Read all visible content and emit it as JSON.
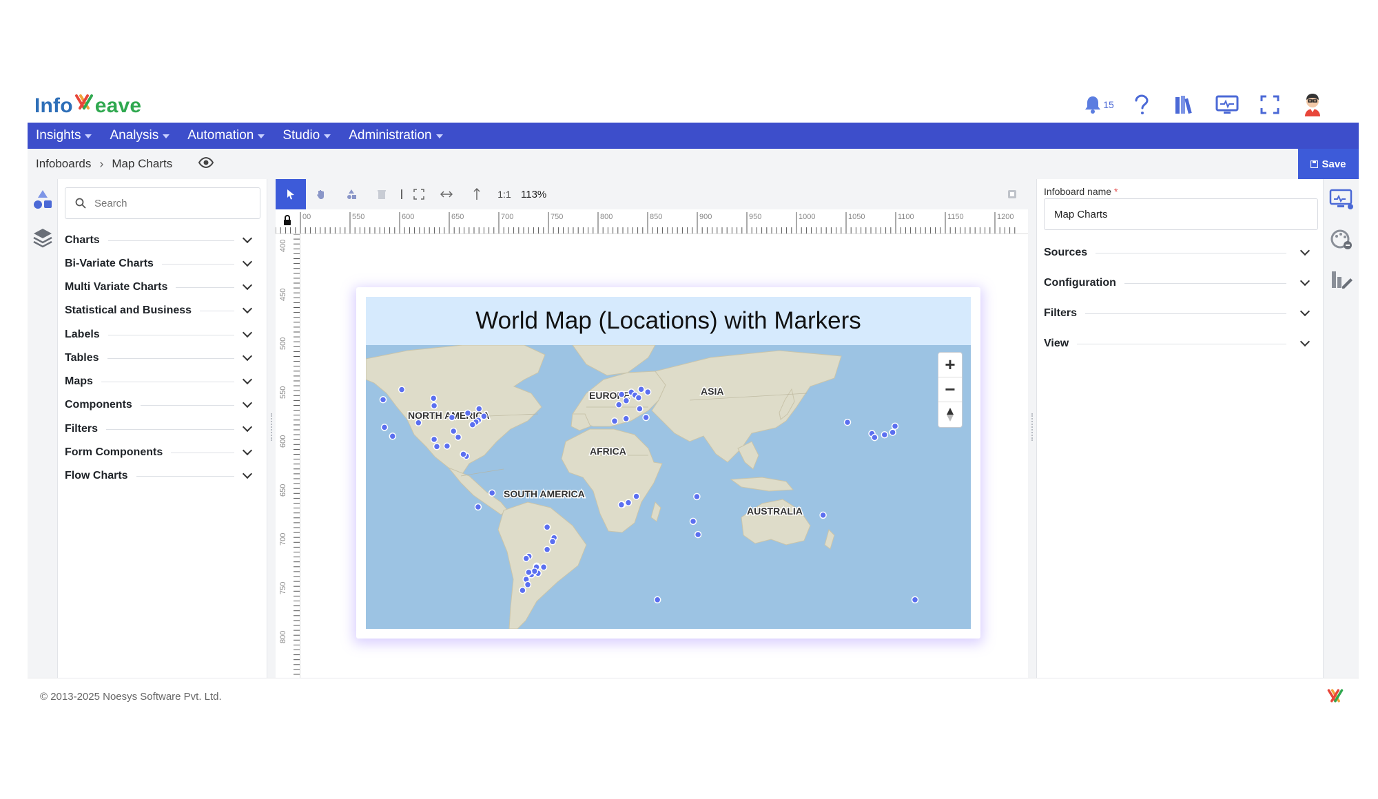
{
  "brand": {
    "name_prefix": "Info",
    "name_suffix": "eave"
  },
  "header": {
    "notification_count": "15"
  },
  "menu": [
    {
      "label": "Insights"
    },
    {
      "label": "Analysis"
    },
    {
      "label": "Automation"
    },
    {
      "label": "Studio"
    },
    {
      "label": "Administration"
    }
  ],
  "breadcrumb": {
    "root": "Infoboards",
    "current": "Map Charts"
  },
  "toolbar": {
    "save_label": "Save",
    "zoom": "113%",
    "ratio": "1:1"
  },
  "components": {
    "search_placeholder": "Search",
    "categories": [
      {
        "label": "Charts"
      },
      {
        "label": "Bi-Variate Charts"
      },
      {
        "label": "Multi Variate Charts"
      },
      {
        "label": "Statistical and Business"
      },
      {
        "label": "Labels"
      },
      {
        "label": "Tables"
      },
      {
        "label": "Maps"
      },
      {
        "label": "Components"
      },
      {
        "label": "Filters"
      },
      {
        "label": "Form Components"
      },
      {
        "label": "Flow Charts"
      }
    ]
  },
  "ruler": {
    "top_ticks": [
      "00",
      "550",
      "600",
      "650",
      "700",
      "750",
      "800",
      "850",
      "900",
      "950",
      "1000",
      "1050",
      "1100",
      "1150",
      "1200"
    ],
    "left_ticks": [
      "400",
      "450",
      "500",
      "550",
      "600",
      "650",
      "700",
      "750",
      "800"
    ]
  },
  "chart": {
    "title": "World Map (Locations) with Markers",
    "regions": [
      "NORTH AMERICA",
      "EUROPE",
      "ASIA",
      "AFRICA",
      "SOUTH AMERICA",
      "AUSTRALIA"
    ],
    "zoom_in": "+",
    "zoom_out": "−"
  },
  "chart_data": {
    "type": "scatter",
    "title": "World Map (Locations) with Markers",
    "marker_color": "#5b6ff0",
    "markers": [
      {
        "lon": -123.1,
        "lat": 49.3
      },
      {
        "lon": -113.5,
        "lat": 53.5
      },
      {
        "lon": -97.1,
        "lat": 49.9
      },
      {
        "lon": -96.8,
        "lat": 46.8
      },
      {
        "lon": -79.4,
        "lat": 43.7
      },
      {
        "lon": -73.6,
        "lat": 45.5
      },
      {
        "lon": -71.1,
        "lat": 42.4
      },
      {
        "lon": -74.0,
        "lat": 40.7
      },
      {
        "lon": -75.2,
        "lat": 40.0
      },
      {
        "lon": -77.0,
        "lat": 38.9
      },
      {
        "lon": -80.2,
        "lat": 25.8
      },
      {
        "lon": -84.4,
        "lat": 33.7
      },
      {
        "lon": -87.6,
        "lat": 41.9
      },
      {
        "lon": -118.2,
        "lat": 34.1
      },
      {
        "lon": -104.9,
        "lat": 39.7
      },
      {
        "lon": -96.8,
        "lat": 32.8
      },
      {
        "lon": -95.4,
        "lat": 29.8
      },
      {
        "lon": -90.1,
        "lat": 30.0
      },
      {
        "lon": -122.4,
        "lat": 37.8
      },
      {
        "lon": -81.7,
        "lat": 26.6
      },
      {
        "lon": -86.8,
        "lat": 36.2
      },
      {
        "lon": -0.1,
        "lat": 51.5
      },
      {
        "lon": 2.3,
        "lat": 48.9
      },
      {
        "lon": 4.9,
        "lat": 52.4
      },
      {
        "lon": 6.8,
        "lat": 51.2
      },
      {
        "lon": 8.7,
        "lat": 50.1
      },
      {
        "lon": 10.0,
        "lat": 53.6
      },
      {
        "lon": -3.7,
        "lat": 40.4
      },
      {
        "lon": 2.2,
        "lat": 41.4
      },
      {
        "lon": 12.5,
        "lat": 41.9
      },
      {
        "lon": 9.2,
        "lat": 45.5
      },
      {
        "lon": -1.5,
        "lat": 47.2
      },
      {
        "lon": 13.4,
        "lat": 52.5
      },
      {
        "lon": 3.4,
        "lat": 6.5
      },
      {
        "lon": 7.5,
        "lat": 9.1
      },
      {
        "lon": 0.2,
        "lat": 5.6
      },
      {
        "lon": -0.2,
        "lat": 5.6
      },
      {
        "lon": 36.8,
        "lat": -1.3
      },
      {
        "lon": 38.7,
        "lat": 9.0
      },
      {
        "lon": 39.3,
        "lat": -6.8
      },
      {
        "lon": 18.4,
        "lat": -33.9
      },
      {
        "lon": 116.4,
        "lat": 39.9
      },
      {
        "lon": 139.7,
        "lat": 35.7
      },
      {
        "lon": 135.5,
        "lat": 34.7
      },
      {
        "lon": 140.9,
        "lat": 38.3
      },
      {
        "lon": 129.0,
        "lat": 35.2
      },
      {
        "lon": 130.4,
        "lat": 33.6
      },
      {
        "lon": 103.8,
        "lat": 1.3
      },
      {
        "lon": 151.2,
        "lat": -33.9
      },
      {
        "lon": -74.1,
        "lat": 4.7
      },
      {
        "lon": -66.9,
        "lat": 10.5
      },
      {
        "lon": -38.5,
        "lat": -3.7
      },
      {
        "lon": -34.9,
        "lat": -8.1
      },
      {
        "lon": -35.7,
        "lat": -9.7
      },
      {
        "lon": -38.5,
        "lat": -13.0
      },
      {
        "lon": -43.2,
        "lat": -22.9
      },
      {
        "lon": -46.6,
        "lat": -23.5
      },
      {
        "lon": -49.3,
        "lat": -25.4
      },
      {
        "lon": -51.2,
        "lat": -30.0
      },
      {
        "lon": -47.9,
        "lat": -15.8
      },
      {
        "lon": -43.9,
        "lat": -19.9
      },
      {
        "lon": -48.5,
        "lat": -27.6
      },
      {
        "lon": -49.3,
        "lat": -16.7
      },
      {
        "lon": -44.0,
        "lat": -20.3
      },
      {
        "lon": -40.3,
        "lat": -20.3
      },
      {
        "lon": -45.0,
        "lat": -22.0
      },
      {
        "lon": -48.0,
        "lat": -22.5
      }
    ]
  },
  "properties": {
    "infoboard_name_label": "Infoboard name",
    "required_mark": "*",
    "infoboard_name_value": "Map Charts",
    "sections": [
      {
        "label": "Sources"
      },
      {
        "label": "Configuration"
      },
      {
        "label": "Filters"
      },
      {
        "label": "View"
      }
    ]
  },
  "footer": {
    "copyright": "© 2013-2025 Noesys Software Pvt. Ltd."
  }
}
